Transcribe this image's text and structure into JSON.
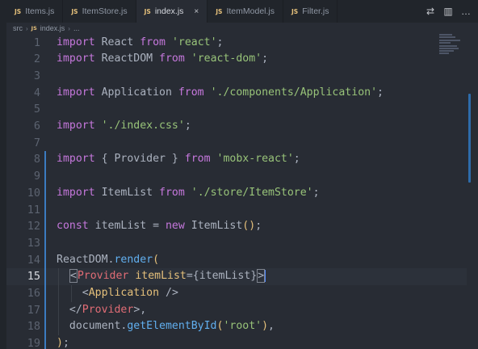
{
  "tabs": [
    {
      "badge": "JS",
      "name": "Items.js",
      "active": false
    },
    {
      "badge": "JS",
      "name": "ItemStore.js",
      "active": false
    },
    {
      "badge": "JS",
      "name": "index.js",
      "active": true,
      "close": "×"
    },
    {
      "badge": "JS",
      "name": "ItemModel.js",
      "active": false
    },
    {
      "badge": "JS",
      "name": "Filter.js",
      "active": false
    }
  ],
  "tab_actions": {
    "compare_icon": "⇄",
    "split_icon": "▥",
    "more_icon": "…"
  },
  "breadcrumb": {
    "folder": "src",
    "sep": "›",
    "badge": "JS",
    "file": "index.js",
    "sep2": "›",
    "more": "..."
  },
  "editor": {
    "current_line": 15,
    "lines": [
      {
        "n": "1",
        "tokens": [
          [
            "k",
            "import"
          ],
          [
            "p",
            " React "
          ],
          [
            "k",
            "from"
          ],
          [
            "p",
            " "
          ],
          [
            "s",
            "'react'"
          ],
          [
            "p",
            ";"
          ]
        ]
      },
      {
        "n": "2",
        "tokens": [
          [
            "k",
            "import"
          ],
          [
            "p",
            " ReactDOM "
          ],
          [
            "k",
            "from"
          ],
          [
            "p",
            " "
          ],
          [
            "s",
            "'react-dom'"
          ],
          [
            "p",
            ";"
          ]
        ]
      },
      {
        "n": "3",
        "tokens": []
      },
      {
        "n": "4",
        "tokens": [
          [
            "k",
            "import"
          ],
          [
            "p",
            " Application "
          ],
          [
            "k",
            "from"
          ],
          [
            "p",
            " "
          ],
          [
            "s",
            "'./components/Application'"
          ],
          [
            "p",
            ";"
          ]
        ]
      },
      {
        "n": "5",
        "tokens": []
      },
      {
        "n": "6",
        "tokens": [
          [
            "k",
            "import"
          ],
          [
            "p",
            " "
          ],
          [
            "s",
            "'./index.css'"
          ],
          [
            "p",
            ";"
          ]
        ]
      },
      {
        "n": "7",
        "tokens": []
      },
      {
        "n": "8",
        "tokens": [
          [
            "k",
            "import"
          ],
          [
            "p",
            " { Provider } "
          ],
          [
            "k",
            "from"
          ],
          [
            "p",
            " "
          ],
          [
            "s",
            "'mobx-react'"
          ],
          [
            "p",
            ";"
          ]
        ]
      },
      {
        "n": "9",
        "tokens": []
      },
      {
        "n": "10",
        "tokens": [
          [
            "k",
            "import"
          ],
          [
            "p",
            " ItemList "
          ],
          [
            "k",
            "from"
          ],
          [
            "p",
            " "
          ],
          [
            "s",
            "'./store/ItemStore'"
          ],
          [
            "p",
            ";"
          ]
        ]
      },
      {
        "n": "11",
        "tokens": []
      },
      {
        "n": "12",
        "tokens": [
          [
            "k",
            "const"
          ],
          [
            "p",
            " itemList = "
          ],
          [
            "k",
            "new"
          ],
          [
            "p",
            " ItemList"
          ],
          [
            "y",
            "("
          ],
          [
            "y",
            ")"
          ],
          [
            "p",
            ";"
          ]
        ]
      },
      {
        "n": "13",
        "tokens": []
      },
      {
        "n": "14",
        "tokens": [
          [
            "p",
            "ReactDOM."
          ],
          [
            "f",
            "render"
          ],
          [
            "y",
            "("
          ]
        ]
      },
      {
        "n": "15",
        "tokens": [
          [
            "p",
            "  "
          ],
          [
            "bm",
            "<"
          ],
          [
            "t",
            "Provider"
          ],
          [
            "p",
            " "
          ],
          [
            "y",
            "itemList"
          ],
          [
            "p",
            "={itemList}"
          ],
          [
            "bm",
            ">"
          ]
        ]
      },
      {
        "n": "16",
        "tokens": [
          [
            "p",
            "    "
          ],
          [
            "p",
            "<"
          ],
          [
            "y",
            "Application"
          ],
          [
            "p",
            " />"
          ]
        ]
      },
      {
        "n": "17",
        "tokens": [
          [
            "p",
            "  "
          ],
          [
            "p",
            "</"
          ],
          [
            "t",
            "Provider"
          ],
          [
            "p",
            ">,"
          ]
        ]
      },
      {
        "n": "18",
        "tokens": [
          [
            "p",
            "  document."
          ],
          [
            "f",
            "getElementById"
          ],
          [
            "y",
            "("
          ],
          [
            "s",
            "'root'"
          ],
          [
            "y",
            ")"
          ],
          [
            "p",
            ","
          ]
        ]
      },
      {
        "n": "19",
        "tokens": [
          [
            "y",
            ")"
          ],
          [
            "p",
            ";"
          ]
        ]
      }
    ]
  }
}
